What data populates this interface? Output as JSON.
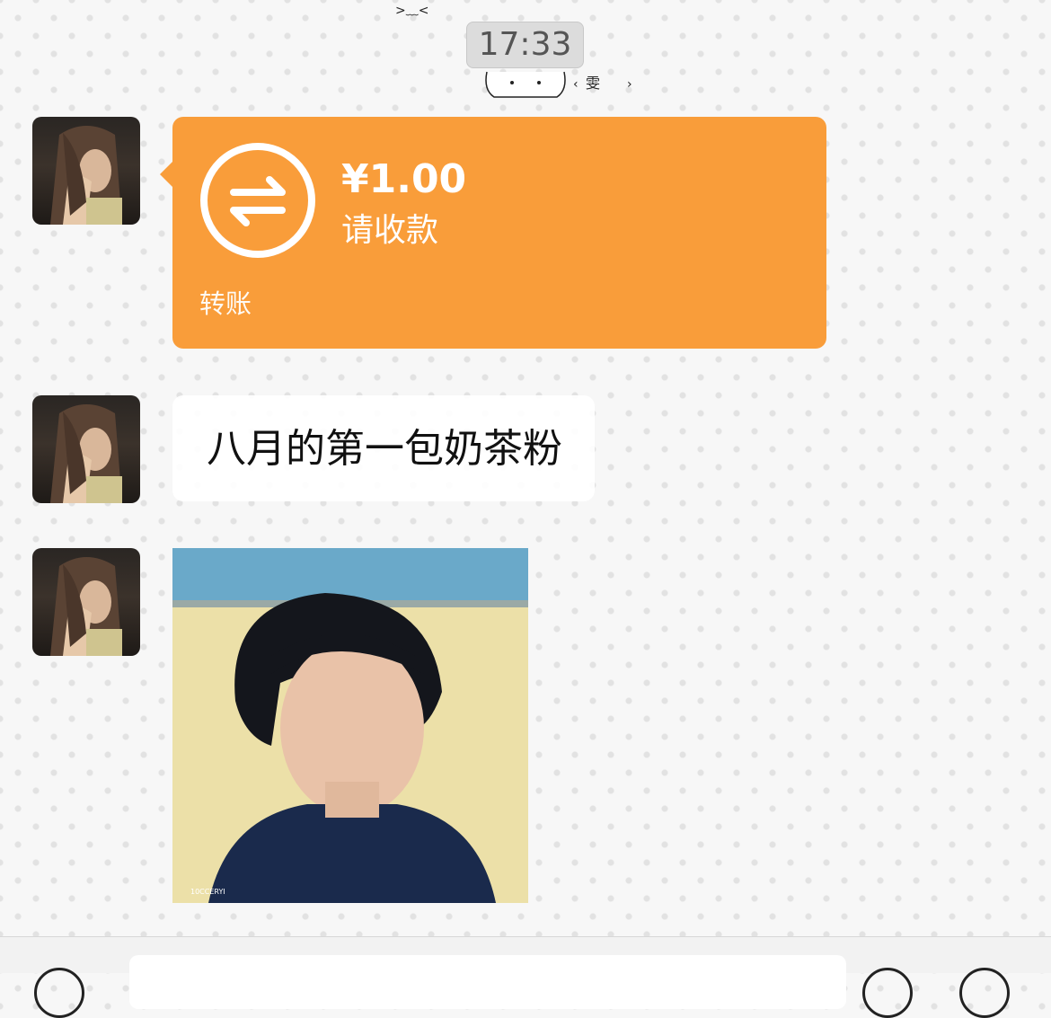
{
  "chat": {
    "timestamp": "17:33",
    "messages": [
      {
        "type": "transfer",
        "amount": "¥1.00",
        "status": "请收款",
        "footer": "转账",
        "icon": "transfer-arrows-icon",
        "color": "#f99d3a"
      },
      {
        "type": "text",
        "text": "八月的第一包奶茶粉"
      },
      {
        "type": "image",
        "watermark": "10CCERYI"
      }
    ]
  },
  "doodle": {
    "text": "雯",
    "face": ">﹏<"
  },
  "colors": {
    "background": "#f7f7f7",
    "transfer_bubble": "#f99d3a",
    "text_bubble": "#ffffff",
    "timestamp_bg": "#dcdcdc"
  }
}
